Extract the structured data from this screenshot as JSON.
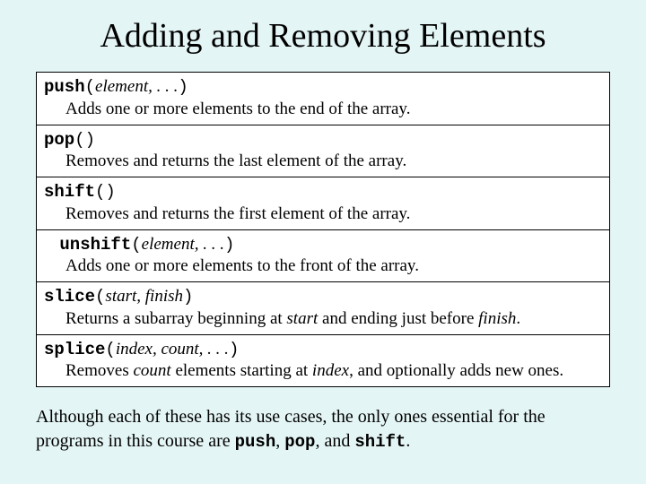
{
  "title": "Adding and Removing Elements",
  "rows": {
    "push": {
      "name": "push",
      "open": "(",
      "args": "element, . . .",
      "close": ")",
      "desc_pre": "Adds one or more elements to the end of the array."
    },
    "pop": {
      "name": "pop",
      "open": "()",
      "args": "",
      "close": "",
      "desc_pre": "Removes and returns the last element of the array."
    },
    "shift": {
      "name": "shift",
      "open": "()",
      "args": "",
      "close": "",
      "desc_pre": "Removes and returns the first element of the array."
    },
    "unshift": {
      "name": "unshift",
      "open": "(",
      "args": "element, . . .",
      "close": ")",
      "desc_pre": "Adds one or more elements to the front of the array."
    },
    "slice": {
      "name": "slice",
      "open": "(",
      "args": "start, finish",
      "close": ")",
      "desc_pre": "Returns a subarray beginning at ",
      "desc_i1": "start",
      "desc_mid": " and ending just before ",
      "desc_i2": "finish",
      "desc_post": "."
    },
    "splice": {
      "name": "splice",
      "open": "(",
      "args": "index, count, . . .",
      "close": ")",
      "desc_pre": "Removes ",
      "desc_i1": "count",
      "desc_mid": " elements starting at ",
      "desc_i2": "index",
      "desc_post": ", and optionally adds new ones."
    }
  },
  "footer": {
    "t1": "Although each of these has its use cases, the only ones essential for the programs in this course are ",
    "m1": "push",
    "t2": ", ",
    "m2": "pop",
    "t3": ", and ",
    "m3": "shift",
    "t4": "."
  }
}
